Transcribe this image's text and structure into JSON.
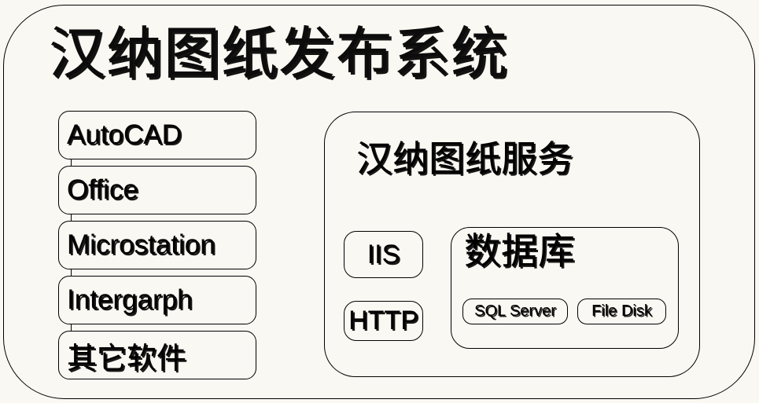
{
  "diagram": {
    "title": "汉纳图纸发布系统",
    "background_color": "#FAF8F2",
    "line_color": "#000000",
    "text_color": "#000000"
  },
  "clients": {
    "items": [
      {
        "label": "AutoCAD",
        "script": "latin"
      },
      {
        "label": "Office",
        "script": "latin"
      },
      {
        "label": "Microstation",
        "script": "latin"
      },
      {
        "label": "Intergarph",
        "script": "latin"
      },
      {
        "label": "其它软件",
        "script": "cjk"
      }
    ]
  },
  "server": {
    "title": "汉纳图纸服务",
    "protocols": [
      {
        "label": "IIS"
      },
      {
        "label": "HTTP"
      }
    ],
    "database": {
      "title": "数据库",
      "stores": [
        {
          "label": "SQL Server"
        },
        {
          "label": "File Disk"
        }
      ]
    }
  }
}
